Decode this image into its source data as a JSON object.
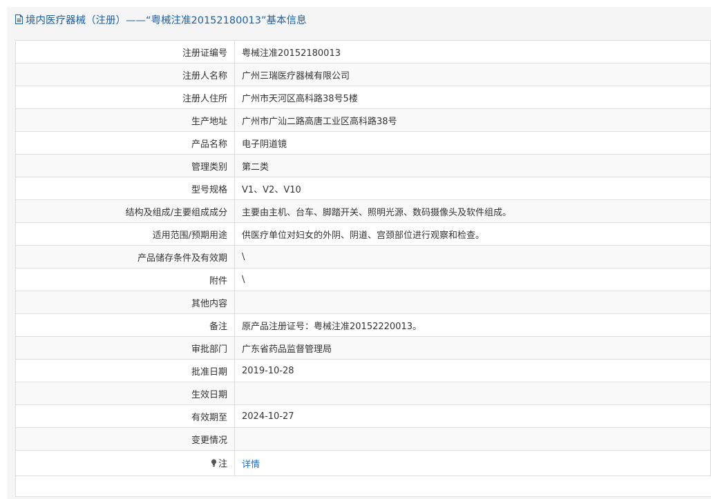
{
  "panel": {
    "title": "境内医疗器械（注册）——“粤械注准20152180013”基本信息",
    "icon": "document-icon"
  },
  "colors": {
    "title": "#1b5fa5",
    "link": "#1b6ec2",
    "header_bg": "#f5f5f5",
    "border": "#dddddd"
  },
  "rows": [
    {
      "label": "注册证编号",
      "value": "粤械注准20152180013"
    },
    {
      "label": "注册人名称",
      "value": "广州三瑞医疗器械有限公司"
    },
    {
      "label": "注册人住所",
      "value": "广州市天河区高科路38号5楼"
    },
    {
      "label": "生产地址",
      "value": "广州市广汕二路高唐工业区高科路38号"
    },
    {
      "label": "产品名称",
      "value": "电子阴道镜"
    },
    {
      "label": "管理类别",
      "value": "第二类"
    },
    {
      "label": "型号规格",
      "value": "V1、V2、V10"
    },
    {
      "label": "结构及组成/主要组成成分",
      "value": "主要由主机、台车、脚踏开关、照明光源、数码摄像头及软件组成。"
    },
    {
      "label": "适用范围/预期用途",
      "value": "供医疗单位对妇女的外阴、阴道、宫颈部位进行观察和检查。"
    },
    {
      "label": "产品储存条件及有效期",
      "value": "\\"
    },
    {
      "label": "附件",
      "value": "\\"
    },
    {
      "label": "其他内容",
      "value": ""
    },
    {
      "label": "备注",
      "value": "原产品注册证号：粤械注准20152220013。"
    },
    {
      "label": "审批部门",
      "value": "广东省药品监督管理局"
    },
    {
      "label": "批准日期",
      "value": "2019-10-28"
    },
    {
      "label": "生效日期",
      "value": ""
    },
    {
      "label": "有效期至",
      "value": "2024-10-27"
    },
    {
      "label": "变更情况",
      "value": ""
    }
  ],
  "note_row": {
    "label": "注",
    "icon": "lightbulb-icon",
    "link_text": "详情"
  }
}
